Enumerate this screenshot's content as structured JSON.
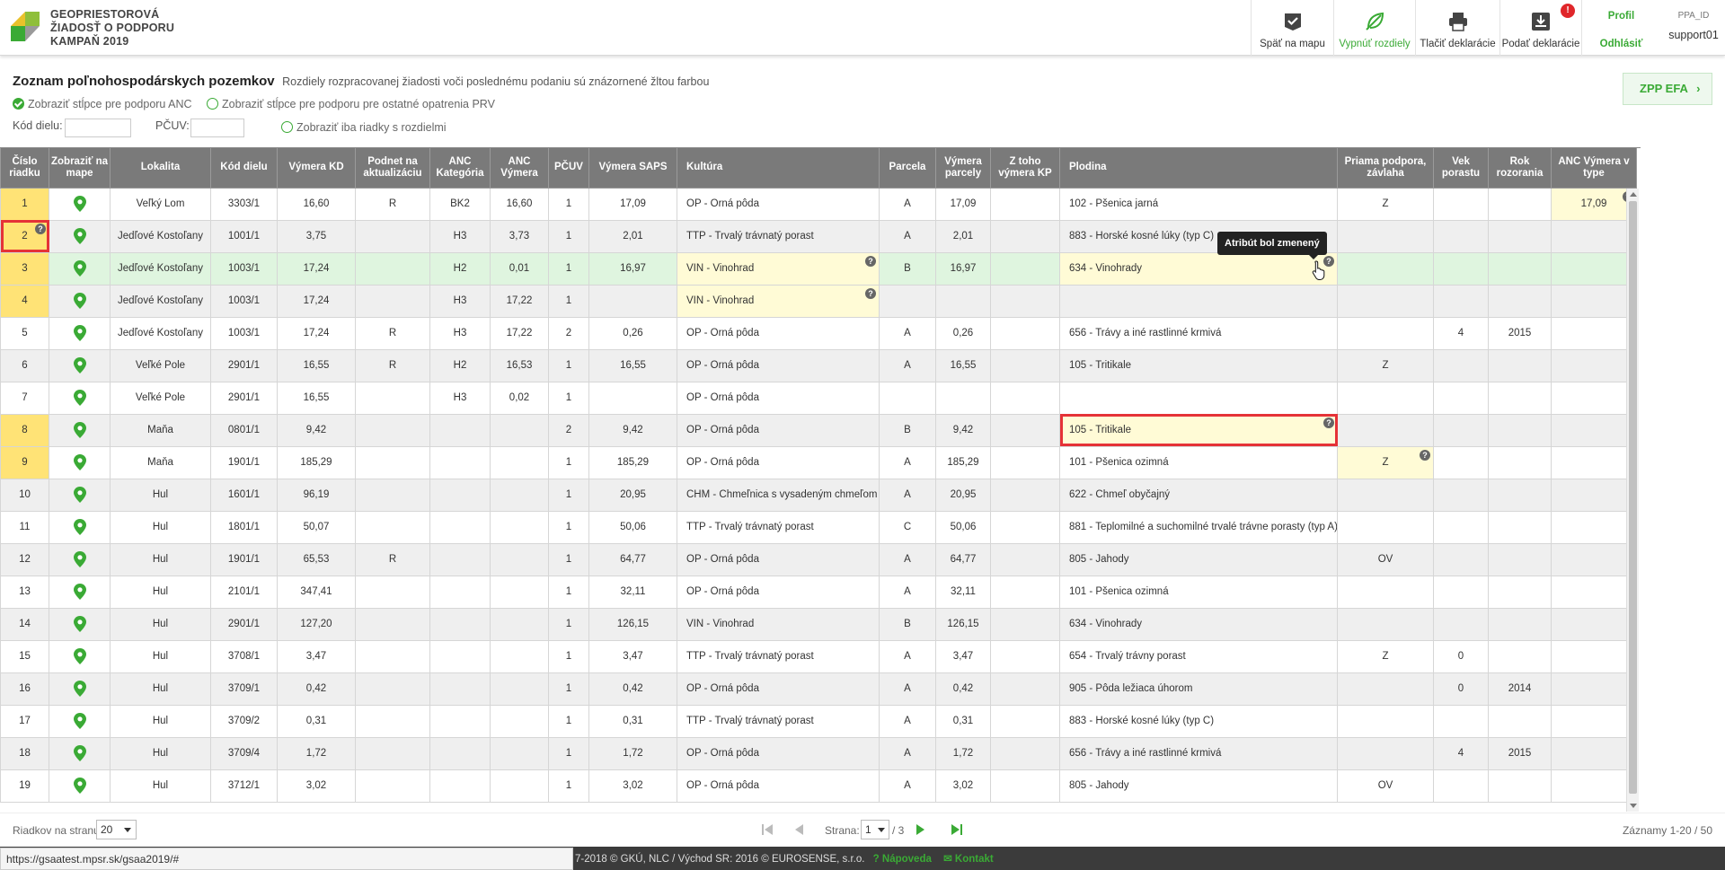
{
  "app": {
    "title_lines": [
      "GEOPRIESTOROVÁ",
      "ŽIADOSŤ O PODPORU",
      "KAMPAŇ 2019"
    ]
  },
  "header": {
    "buttons": [
      {
        "label": "Späť na mapu",
        "icon": "map-check-icon"
      },
      {
        "label": "Vypnúť rozdiely",
        "icon": "leaf-off-icon"
      },
      {
        "label": "Tlačiť deklarácie",
        "icon": "printer-icon"
      },
      {
        "label": "Podať deklarácie",
        "icon": "download-tray-icon"
      }
    ],
    "notification_badge": "!",
    "profile_label": "Profil",
    "logout_label": "Odhlásiť",
    "ppa_id_label": "PPA_ID",
    "username": "support01"
  },
  "page": {
    "title": "Zoznam poľnohospodárskych pozemkov",
    "subtitle": "Rozdiely rozpracovanej žiadosti voči poslednému podaniu sú znázornené žltou farbou",
    "options": [
      {
        "label": "Zobraziť stĺpce pre podporu ANC",
        "checked": true
      },
      {
        "label": "Zobraziť stĺpce pre podporu pre ostatné opatrenia PRV",
        "checked": false
      }
    ],
    "filter_kd_label": "Kód dielu:",
    "filter_kd_value": "",
    "filter_pcuv_label": "PČUV:",
    "filter_pcuv_value": "",
    "only_diff_label": "Zobraziť iba riadky s rozdielmi",
    "zpp_button": "ZPP EFA"
  },
  "table": {
    "columns": [
      "Číslo riadku",
      "Zobraziť na mape",
      "Lokalita",
      "Kód dielu",
      "Výmera KD",
      "Podnet na aktualizáciu",
      "ANC Kategória",
      "ANC Výmera",
      "PČUV",
      "Výmera SAPS",
      "Kultúra",
      "Parcela",
      "Výmera parcely",
      "Z toho výmera KP",
      "Plodina",
      "Priama podpora, závlaha",
      "Vek porastu",
      "Rok rozorania",
      "ANC Výmera v type"
    ],
    "rows": [
      {
        "n": "1",
        "lok": "Veľký Lom",
        "kd": "3303/1",
        "vkd": "16,60",
        "pod": "R",
        "anck": "BK2",
        "ancv": "16,60",
        "pcuv": "1",
        "saps": "17,09",
        "kul": "OP - Orná pôda",
        "par": "A",
        "vpar": "17,09",
        "kp": "",
        "plod": "102 - Pšenica jarná",
        "ppz": "Z",
        "vek": "",
        "rok": "",
        "ancvt": "17,09"
      },
      {
        "n": "2",
        "lok": "Jedľové Kostoľany",
        "kd": "1001/1",
        "vkd": "3,75",
        "pod": "",
        "anck": "H3",
        "ancv": "3,73",
        "pcuv": "1",
        "saps": "2,01",
        "kul": "TTP - Trvalý trávnatý porast",
        "par": "A",
        "vpar": "2,01",
        "kp": "",
        "plod": "883 - Horské kosné lúky (typ C)",
        "ppz": "",
        "vek": "",
        "rok": "",
        "ancvt": ""
      },
      {
        "n": "3",
        "lok": "Jedľové Kostoľany",
        "kd": "1003/1",
        "vkd": "17,24",
        "pod": "",
        "anck": "H2",
        "ancv": "0,01",
        "pcuv": "1",
        "saps": "16,97",
        "kul": "VIN - Vinohrad",
        "par": "B",
        "vpar": "16,97",
        "kp": "",
        "plod": "634 - Vinohrady",
        "ppz": "",
        "vek": "",
        "rok": "",
        "ancvt": ""
      },
      {
        "n": "4",
        "lok": "Jedľové Kostoľany",
        "kd": "1003/1",
        "vkd": "17,24",
        "pod": "",
        "anck": "H3",
        "ancv": "17,22",
        "pcuv": "1",
        "saps": "",
        "kul": "VIN - Vinohrad",
        "par": "",
        "vpar": "",
        "kp": "",
        "plod": "",
        "ppz": "",
        "vek": "",
        "rok": "",
        "ancvt": ""
      },
      {
        "n": "5",
        "lok": "Jedľové Kostoľany",
        "kd": "1003/1",
        "vkd": "17,24",
        "pod": "R",
        "anck": "H3",
        "ancv": "17,22",
        "pcuv": "2",
        "saps": "0,26",
        "kul": "OP - Orná pôda",
        "par": "A",
        "vpar": "0,26",
        "kp": "",
        "plod": "656 - Trávy a iné rastlinné krmivá",
        "ppz": "",
        "vek": "4",
        "rok": "2015",
        "ancvt": ""
      },
      {
        "n": "6",
        "lok": "Veľké Pole",
        "kd": "2901/1",
        "vkd": "16,55",
        "pod": "R",
        "anck": "H2",
        "ancv": "16,53",
        "pcuv": "1",
        "saps": "16,55",
        "kul": "OP - Orná pôda",
        "par": "A",
        "vpar": "16,55",
        "kp": "",
        "plod": "105 - Tritikale",
        "ppz": "Z",
        "vek": "",
        "rok": "",
        "ancvt": ""
      },
      {
        "n": "7",
        "lok": "Veľké Pole",
        "kd": "2901/1",
        "vkd": "16,55",
        "pod": "",
        "anck": "H3",
        "ancv": "0,02",
        "pcuv": "1",
        "saps": "",
        "kul": "OP - Orná pôda",
        "par": "",
        "vpar": "",
        "kp": "",
        "plod": "",
        "ppz": "",
        "vek": "",
        "rok": "",
        "ancvt": ""
      },
      {
        "n": "8",
        "lok": "Maňa",
        "kd": "0801/1",
        "vkd": "9,42",
        "pod": "",
        "anck": "",
        "ancv": "",
        "pcuv": "2",
        "saps": "9,42",
        "kul": "OP - Orná pôda",
        "par": "B",
        "vpar": "9,42",
        "kp": "",
        "plod": "105 - Tritikale",
        "ppz": "",
        "vek": "",
        "rok": "",
        "ancvt": ""
      },
      {
        "n": "9",
        "lok": "Maňa",
        "kd": "1901/1",
        "vkd": "185,29",
        "pod": "",
        "anck": "",
        "ancv": "",
        "pcuv": "1",
        "saps": "185,29",
        "kul": "OP - Orná pôda",
        "par": "A",
        "vpar": "185,29",
        "kp": "",
        "plod": "101 - Pšenica ozimná",
        "ppz": "Z",
        "vek": "",
        "rok": "",
        "ancvt": ""
      },
      {
        "n": "10",
        "lok": "Hul",
        "kd": "1601/1",
        "vkd": "96,19",
        "pod": "",
        "anck": "",
        "ancv": "",
        "pcuv": "1",
        "saps": "20,95",
        "kul": "CHM - Chmeľnica s vysadeným chmeľom",
        "par": "A",
        "vpar": "20,95",
        "kp": "",
        "plod": "622 - Chmeľ obyčajný",
        "ppz": "",
        "vek": "",
        "rok": "",
        "ancvt": ""
      },
      {
        "n": "11",
        "lok": "Hul",
        "kd": "1801/1",
        "vkd": "50,07",
        "pod": "",
        "anck": "",
        "ancv": "",
        "pcuv": "1",
        "saps": "50,06",
        "kul": "TTP - Trvalý trávnatý porast",
        "par": "C",
        "vpar": "50,06",
        "kp": "",
        "plod": "881 - Teplomilné a suchomilné trvalé trávne porasty (typ A)",
        "ppz": "",
        "vek": "",
        "rok": "",
        "ancvt": ""
      },
      {
        "n": "12",
        "lok": "Hul",
        "kd": "1901/1",
        "vkd": "65,53",
        "pod": "R",
        "anck": "",
        "ancv": "",
        "pcuv": "1",
        "saps": "64,77",
        "kul": "OP - Orná pôda",
        "par": "A",
        "vpar": "64,77",
        "kp": "",
        "plod": "805 - Jahody",
        "ppz": "OV",
        "vek": "",
        "rok": "",
        "ancvt": ""
      },
      {
        "n": "13",
        "lok": "Hul",
        "kd": "2101/1",
        "vkd": "347,41",
        "pod": "",
        "anck": "",
        "ancv": "",
        "pcuv": "1",
        "saps": "32,11",
        "kul": "OP - Orná pôda",
        "par": "A",
        "vpar": "32,11",
        "kp": "",
        "plod": "101 - Pšenica ozimná",
        "ppz": "",
        "vek": "",
        "rok": "",
        "ancvt": ""
      },
      {
        "n": "14",
        "lok": "Hul",
        "kd": "2901/1",
        "vkd": "127,20",
        "pod": "",
        "anck": "",
        "ancv": "",
        "pcuv": "1",
        "saps": "126,15",
        "kul": "VIN - Vinohrad",
        "par": "B",
        "vpar": "126,15",
        "kp": "",
        "plod": "634 - Vinohrady",
        "ppz": "",
        "vek": "",
        "rok": "",
        "ancvt": ""
      },
      {
        "n": "15",
        "lok": "Hul",
        "kd": "3708/1",
        "vkd": "3,47",
        "pod": "",
        "anck": "",
        "ancv": "",
        "pcuv": "1",
        "saps": "3,47",
        "kul": "TTP - Trvalý trávnatý porast",
        "par": "A",
        "vpar": "3,47",
        "kp": "",
        "plod": "654 - Trvalý trávny porast",
        "ppz": "Z",
        "vek": "0",
        "rok": "",
        "ancvt": ""
      },
      {
        "n": "16",
        "lok": "Hul",
        "kd": "3709/1",
        "vkd": "0,42",
        "pod": "",
        "anck": "",
        "ancv": "",
        "pcuv": "1",
        "saps": "0,42",
        "kul": "OP - Orná pôda",
        "par": "A",
        "vpar": "0,42",
        "kp": "",
        "plod": "905 - Pôda ležiaca úhorom",
        "ppz": "",
        "vek": "0",
        "rok": "2014",
        "ancvt": ""
      },
      {
        "n": "17",
        "lok": "Hul",
        "kd": "3709/2",
        "vkd": "0,31",
        "pod": "",
        "anck": "",
        "ancv": "",
        "pcuv": "1",
        "saps": "0,31",
        "kul": "TTP - Trvalý trávnatý porast",
        "par": "A",
        "vpar": "0,31",
        "kp": "",
        "plod": "883 - Horské kosné lúky (typ C)",
        "ppz": "",
        "vek": "",
        "rok": "",
        "ancvt": ""
      },
      {
        "n": "18",
        "lok": "Hul",
        "kd": "3709/4",
        "vkd": "1,72",
        "pod": "",
        "anck": "",
        "ancv": "",
        "pcuv": "1",
        "saps": "1,72",
        "kul": "OP - Orná pôda",
        "par": "A",
        "vpar": "1,72",
        "kp": "",
        "plod": "656 - Trávy a iné rastlinné krmivá",
        "ppz": "",
        "vek": "4",
        "rok": "2015",
        "ancvt": ""
      },
      {
        "n": "19",
        "lok": "Hul",
        "kd": "3712/1",
        "vkd": "3,02",
        "pod": "",
        "anck": "",
        "ancv": "",
        "pcuv": "1",
        "saps": "3,02",
        "kul": "OP - Orná pôda",
        "par": "A",
        "vpar": "3,02",
        "kp": "",
        "plod": "805 - Jahody",
        "ppz": "OV",
        "vek": "",
        "rok": "",
        "ancvt": ""
      }
    ],
    "tooltip": "Atribút bol zmenený"
  },
  "footer": {
    "per_page_label": "Riadkov na stranu",
    "per_page_value": "20",
    "page_label": "Strana:",
    "page_value": "1",
    "page_total": "/ 3",
    "records": "Záznamy 1-20 / 50"
  },
  "bottombar": {
    "copyright": "7-2018 © GKÚ, NLC / Východ SR: 2016 © EUROSENSE, s.r.o.",
    "help": "Nápoveda",
    "contact": "Kontakt"
  },
  "status_url": "https://gsaatest.mpsr.sk/gsaa2019/#",
  "colors": {
    "accent": "#3aaa35",
    "diff_yellow": "#fff9cc",
    "highlight_red": "#e53237",
    "header_gray": "#7a7a7a"
  }
}
